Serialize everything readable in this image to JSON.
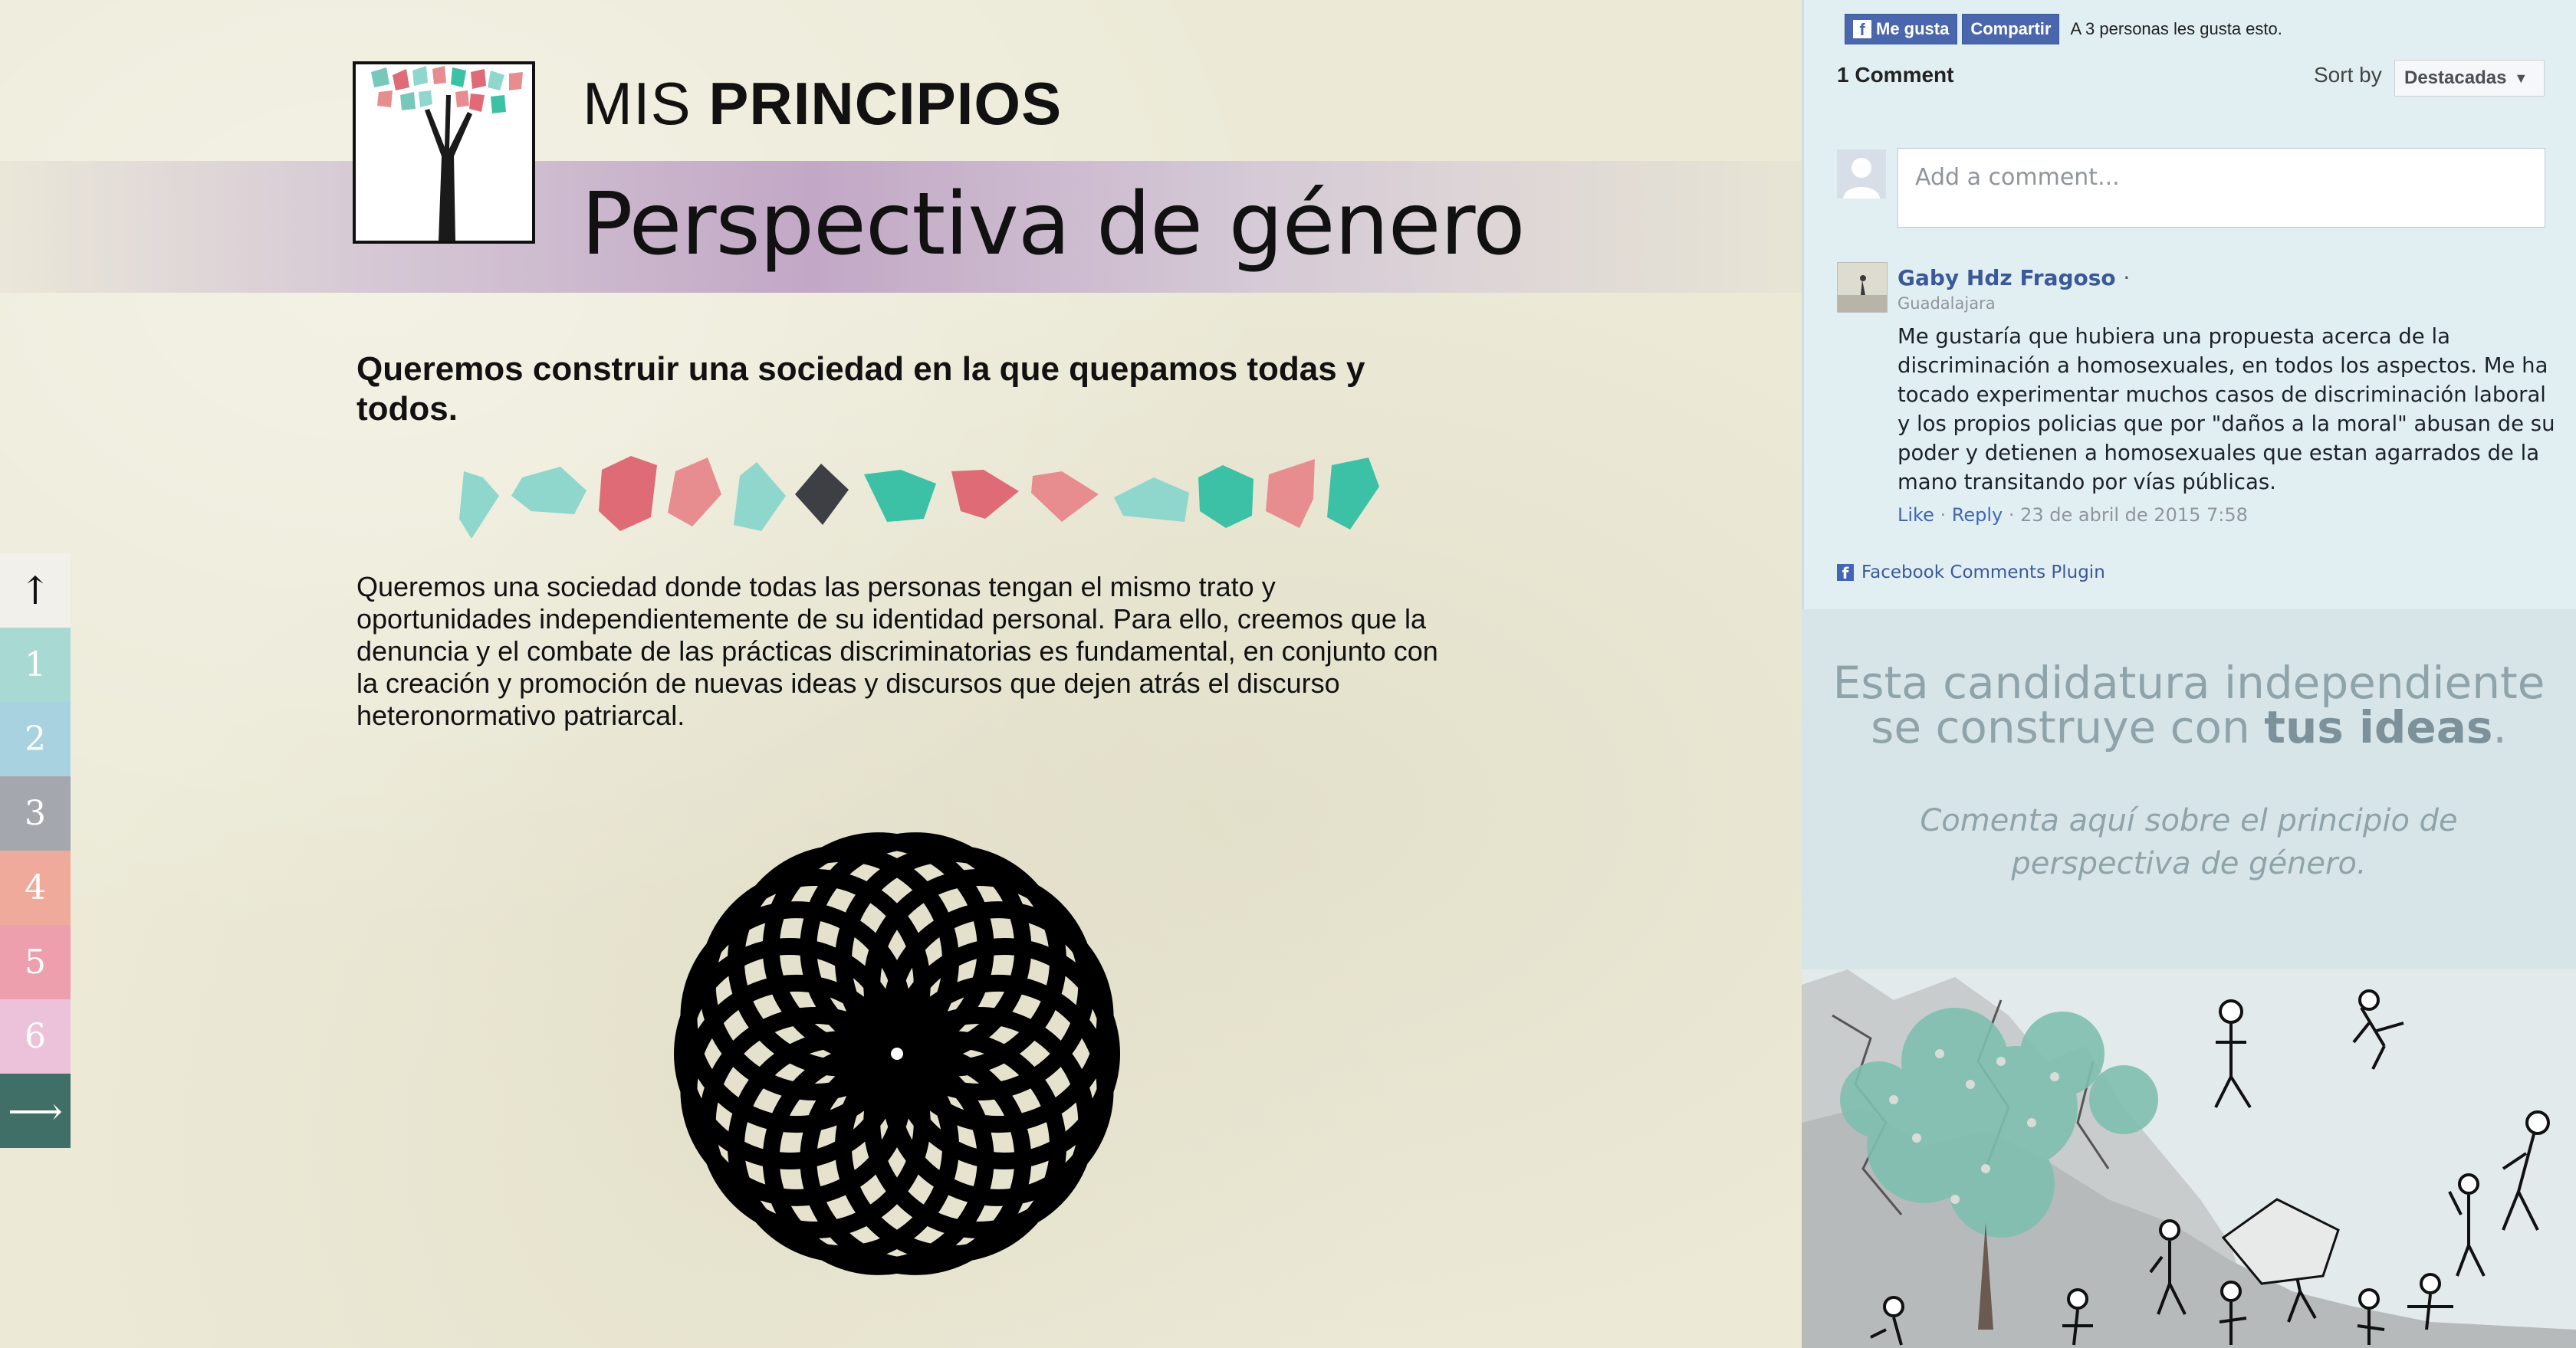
{
  "header": {
    "mis": "MIS",
    "principios": "PRINCIPIOS",
    "title": "Perspectiva de género"
  },
  "main": {
    "subtitle": "Queremos construir una sociedad en la que quepamos todas y todos.",
    "body": "Queremos una sociedad donde todas las personas tengan el mismo trato y oportunidades independientemente de su identidad personal. Para ello, creemos que la denuncia y el combate de las prácticas discriminatorias es fundamental, en conjunto con la creación y promoción de nuevas ideas y discursos que dejen atrás el discurso heteronormativo patriarcal."
  },
  "colors": {
    "mint": "#8fd6cc",
    "coral": "#de6b76",
    "salmon": "#e78d8f",
    "teal": "#3cc1a6",
    "dark": "#3d3f44"
  },
  "side_nav": {
    "up": "↑",
    "items": [
      {
        "label": "1",
        "color": "#a8d9d3"
      },
      {
        "label": "2",
        "color": "#a8d2df"
      },
      {
        "label": "3",
        "color": "#a4a7ad"
      },
      {
        "label": "4",
        "color": "#efaa9c"
      },
      {
        "label": "5",
        "color": "#ed9fae"
      },
      {
        "label": "6",
        "color": "#ebc2da"
      }
    ],
    "next": "⟶"
  },
  "facebook": {
    "like_button": "Me gusta",
    "share_button": "Compartir",
    "like_count_text": "A 3 personas les gusta esto.",
    "comment_count": "1 Comment",
    "sort_label": "Sort by",
    "sort_value": "Destacadas",
    "input_placeholder": "Add a comment...",
    "comment": {
      "author": "Gaby Hdz Fragoso",
      "author_suffix": "·",
      "location": "Guadalajara",
      "text": "Me gustaría que hubiera una propuesta acerca de la discriminación a homosexuales, en todos los aspectos. Me ha tocado experimentar muchos casos de discriminación laboral y los propios policias que por \"daños a la moral\" abusan de su poder y detienen a homosexuales que estan agarrados de la mano transitando por vías públicas.",
      "like": "Like",
      "sep1": " · ",
      "reply": "Reply",
      "sep2": " · ",
      "date": "23 de abril de 2015 7:58"
    },
    "plugin_label": "Facebook Comments Plugin"
  },
  "cta": {
    "line1": "Esta candidatura independiente",
    "line2_start": "se construye con ",
    "line2_bold": "tus ideas",
    "line2_end": ".",
    "sub1": "Comenta aquí sobre el principio de",
    "sub2": "perspectiva de género."
  }
}
